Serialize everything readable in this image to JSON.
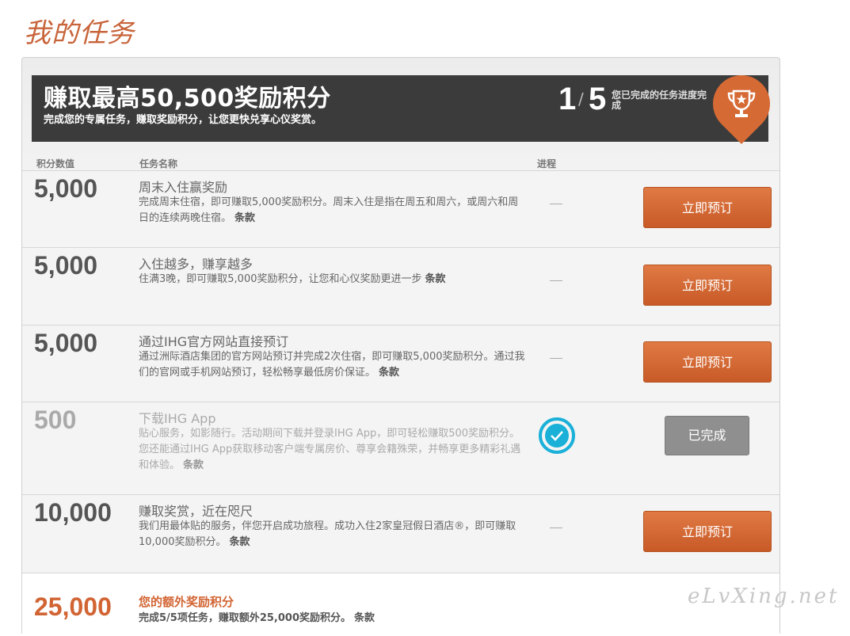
{
  "page_title": "我的任务",
  "banner": {
    "title": "赚取最高50,500奖励积分",
    "subtitle": "完成您的专属任务，赚取奖励积分，让您更快兑享心仪奖赏。",
    "progress_done": "1",
    "progress_slash": "/",
    "progress_total": "5",
    "progress_label": "您已完成的任务进度完成",
    "trophy_icon": "trophy-icon",
    "badge_color": "#d66a35"
  },
  "columns": {
    "points": "积分数值",
    "task": "任务名称",
    "progress": "进程"
  },
  "tasks": [
    {
      "points": "5,000",
      "name": "周末入住赢奖励",
      "desc": "完成周末住宿，即可赚取5,000奖励积分。周末入住是指在周五和周六，或周六和周日的连续两晚住宿。",
      "terms": "条款",
      "progress": "—",
      "button": "立即预订",
      "status": "open"
    },
    {
      "points": "5,000",
      "name": "入住越多，赚享越多",
      "desc": "住满3晚，即可赚取5,000奖励积分，让您和心仪奖励更进一步",
      "terms": "条款",
      "progress": "—",
      "button": "立即预订",
      "status": "open"
    },
    {
      "points": "5,000",
      "name": "通过IHG官方网站直接预订",
      "desc": "通过洲际酒店集团的官方网站预订并完成2次住宿，即可赚取5,000奖励积分。通过我们的官网或手机网站预订，轻松畅享最低房价保证。",
      "terms": "条款",
      "progress": "—",
      "button": "立即预订",
      "status": "open"
    },
    {
      "points": "500",
      "name": "下载IHG App",
      "desc": "贴心服务，如影随行。活动期间下载并登录IHG App，即可轻松赚取500奖励积分。您还能通过IHG App获取移动客户端专属房价、尊享会籍殊荣，并畅享更多精彩礼遇和体验。",
      "terms": "条款",
      "progress": "completed",
      "button": "已完成",
      "status": "done"
    },
    {
      "points": "10,000",
      "name": "赚取奖赏，近在咫尺",
      "desc": "我们用最体贴的服务，伴您开启成功旅程。成功入住2家皇冠假日酒店®，即可赚取10,000奖励积分。",
      "terms": "条款",
      "progress": "—",
      "button": "立即预订",
      "status": "open"
    }
  ],
  "bonus": {
    "points": "25,000",
    "name": "您的额外奖励积分",
    "desc": "完成5/5项任务，赚取额外25,000奖励积分。",
    "terms": "条款"
  },
  "watermark": "eLvXing.net",
  "colors": {
    "accent": "#c8643a",
    "button": "#d26a35",
    "check": "#1ab0d8"
  }
}
